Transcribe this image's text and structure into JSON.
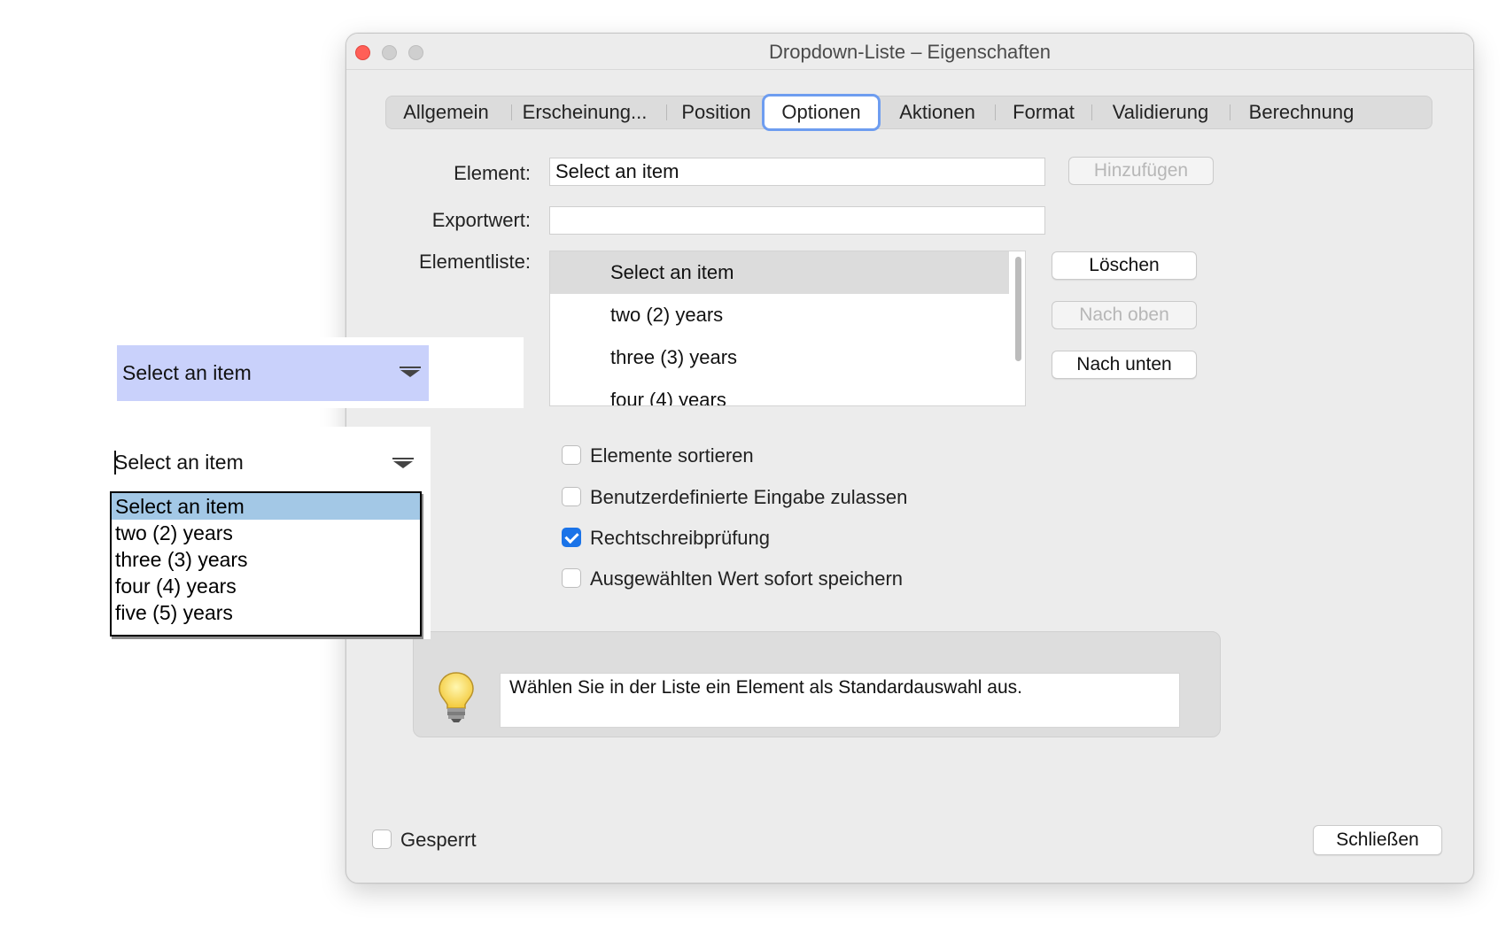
{
  "window": {
    "title": "Dropdown-Liste – Eigenschaften"
  },
  "tabs": [
    {
      "label": "Allgemein"
    },
    {
      "label": "Erscheinung..."
    },
    {
      "label": "Position"
    },
    {
      "label": "Optionen",
      "active": true
    },
    {
      "label": "Aktionen"
    },
    {
      "label": "Format"
    },
    {
      "label": "Validierung"
    },
    {
      "label": "Berechnung"
    }
  ],
  "form": {
    "element_label": "Element:",
    "element_value": "Select an item",
    "exportwert_label": "Exportwert:",
    "exportwert_value": "",
    "elementliste_label": "Elementliste:",
    "add_button": "Hinzufügen",
    "delete_button": "Löschen",
    "up_button": "Nach oben",
    "down_button": "Nach unten"
  },
  "element_list": [
    {
      "label": "Select an item",
      "selected": true
    },
    {
      "label": "two (2) years"
    },
    {
      "label": "three (3) years"
    },
    {
      "label": "four (4) years"
    }
  ],
  "options": [
    {
      "label": "Elemente sortieren",
      "checked": false
    },
    {
      "label": "Benutzerdefinierte Eingabe zulassen",
      "checked": false
    },
    {
      "label": "Rechtschreibprüfung",
      "checked": true
    },
    {
      "label": "Ausgewählten Wert sofort speichern",
      "checked": false
    }
  ],
  "hint": {
    "icon": "lightbulb-icon",
    "text": "Wählen Sie in der Liste ein Element als Standardauswahl aus."
  },
  "footer": {
    "locked_label": "Gesperrt",
    "locked_checked": false,
    "close_button": "Schließen"
  },
  "preview": {
    "dropdown1_value": "Select an item",
    "dropdown2_value": "Select an item",
    "popup_items": [
      {
        "label": "Select an item",
        "selected": true
      },
      {
        "label": "two (2) years"
      },
      {
        "label": "three (3) years"
      },
      {
        "label": "four (4) years"
      },
      {
        "label": "five (5) years"
      }
    ]
  },
  "colors": {
    "accent_tab_border": "#6e9df0",
    "checkbox_checked": "#1a73e8",
    "dropdown_highlight": "#c9d1fb",
    "popup_selection": "#a3c8e6"
  }
}
